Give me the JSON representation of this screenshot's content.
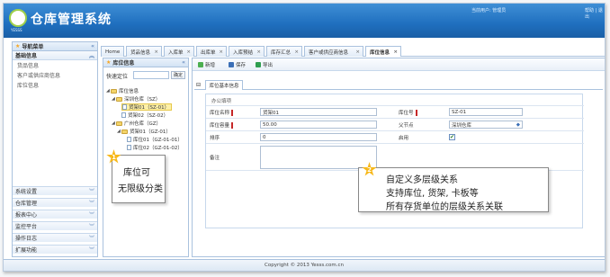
{
  "header": {
    "title": "仓库管理系统",
    "logo_text": "YESSS",
    "user": "当前用户: 管理员",
    "help": "帮助 | 退出"
  },
  "sidebar": {
    "title": "导航菜单",
    "section": "基础信息",
    "items": [
      "货品信息",
      "客户或供应商信息",
      "库位信息"
    ],
    "groups": [
      "系统设置",
      "仓库管理",
      "报表中心",
      "监控平台",
      "操作日志",
      "扩展功能"
    ]
  },
  "tabs": [
    "Home",
    "货品信息",
    "入库单",
    "出库单",
    "入库预结",
    "库存汇总",
    "客户或供应商信息",
    "库位信息"
  ],
  "tree": {
    "title": "库位信息",
    "locate_label": "快速定位",
    "locate_button": "确定",
    "nodes": [
      "库位信息",
      "深圳仓库（SZ）",
      "货架01（SZ-01）",
      "货架02（SZ-02）",
      "广州仓库（GZ）",
      "货架01（GZ-01）",
      "库位01（GZ-01-01）",
      "库位02（GZ-01-02）"
    ]
  },
  "toolbar": {
    "add": "新增",
    "save": "保存",
    "export": "导出"
  },
  "subtab": "库位基本信息",
  "form": {
    "section": "办公填项",
    "name_label": "库位名称",
    "name_value": "货架01",
    "code_label": "库位号",
    "code_value": "SZ-01",
    "capacity_label": "库位容量",
    "capacity_value": "50.00",
    "parent_label": "父节点",
    "parent_value": "深圳仓库",
    "order_label": "排序",
    "order_value": "0",
    "enable_label": "启用",
    "enable_checked": "✔",
    "remark_label": "备注"
  },
  "footer": "Copyright © 2013 Yesss.com.cn",
  "callouts": {
    "one_num": "1",
    "one_l1": "库位可",
    "one_l2": "无限级分类",
    "two_num": "2",
    "two_l1": "自定义多层级关系",
    "two_l2": "支持库位, 货架, 卡板等",
    "two_l3": "所有存货单位的层级关系关联"
  }
}
